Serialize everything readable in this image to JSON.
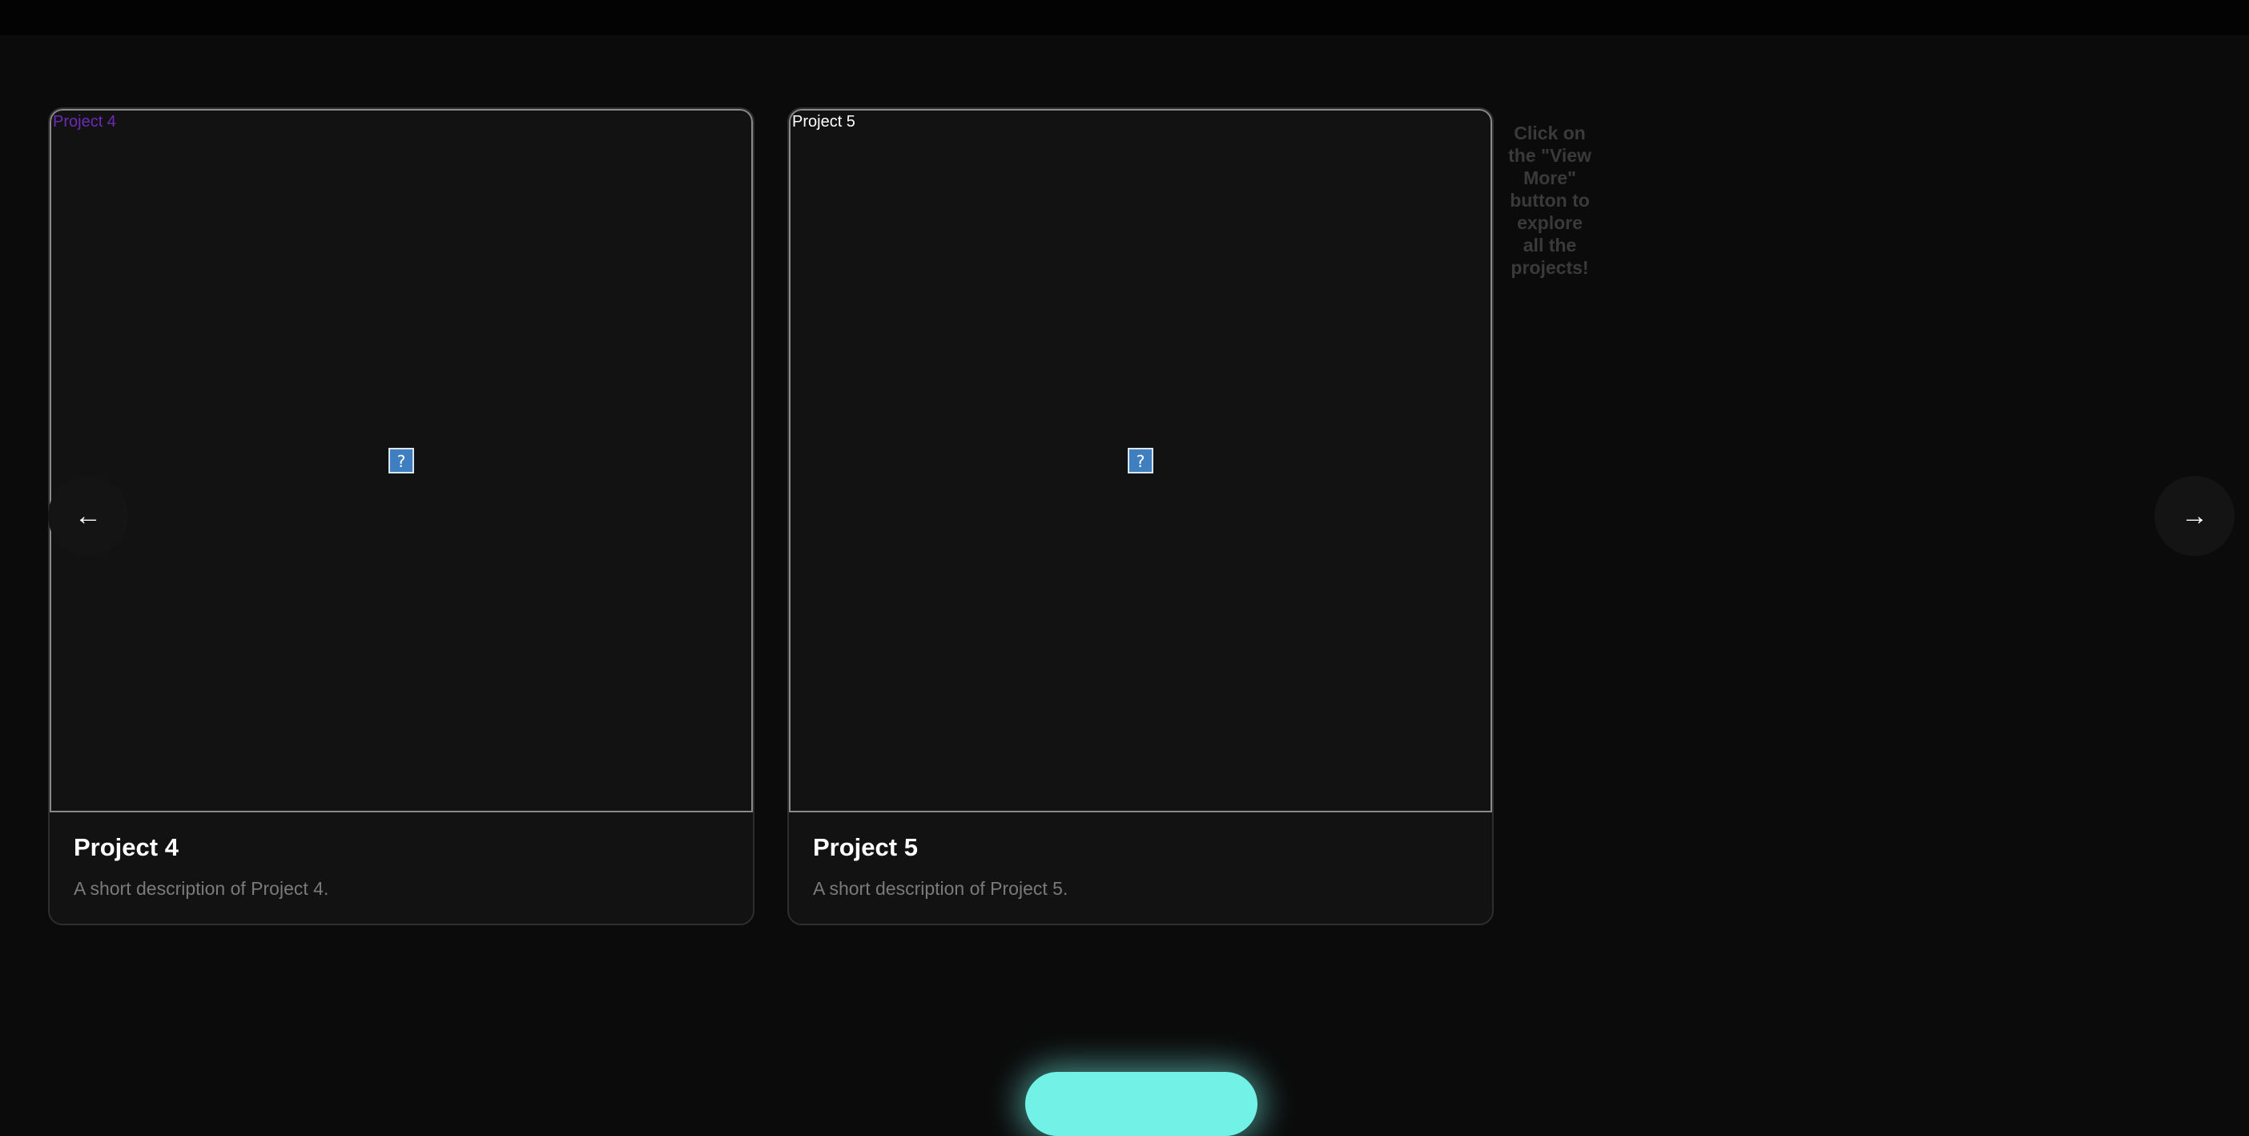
{
  "cards": [
    {
      "image_alt": "Project 4",
      "title": "Project 4",
      "description": "A short description of Project 4."
    },
    {
      "image_alt": "Project 5",
      "title": "Project 5",
      "description": "A short description of Project 5."
    }
  ],
  "carousel": {
    "prev_symbol": "←",
    "next_symbol": "→"
  },
  "hint": {
    "text": "Click on the \"View More\" button to explore all the projects!"
  },
  "icons": {
    "broken_image": "broken-image-icon",
    "prev": "arrow-left-icon",
    "next": "arrow-right-icon"
  },
  "colors": {
    "background": "#0b0b0b",
    "card": "#121212",
    "accent": "#72f1e6",
    "visited_link": "#6b2bb5"
  }
}
